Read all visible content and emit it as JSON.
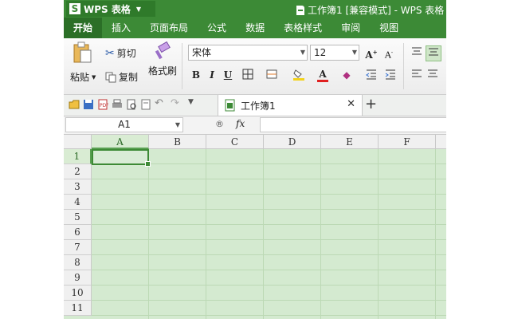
{
  "app": {
    "logo_text": "WPS 表格",
    "window_title": "工作簿1 [兼容模式] - WPS 表格"
  },
  "tabs": [
    "开始",
    "插入",
    "页面布局",
    "公式",
    "数据",
    "表格样式",
    "审阅",
    "视图"
  ],
  "ribbon": {
    "paste_label": "粘贴",
    "cut_label": "剪切",
    "copy_label": "复制",
    "format_painter_label": "格式刷",
    "font_name": "宋体",
    "font_size": "12"
  },
  "quick_access": {
    "document_tab": "工作簿1",
    "add_tab": "+"
  },
  "formula_bar": {
    "name_box": "A1",
    "fx_label": "fx",
    "formula_value": ""
  },
  "sheet": {
    "columns": [
      "A",
      "B",
      "C",
      "D",
      "E",
      "F"
    ],
    "rows": [
      "1",
      "2",
      "3",
      "4",
      "5",
      "6",
      "7",
      "8",
      "9",
      "10",
      "11"
    ],
    "active_cell": "A1"
  },
  "colors": {
    "brand_green": "#3c8a36",
    "cell_background": "#d4ead0",
    "selection_border": "#3d8a35"
  }
}
